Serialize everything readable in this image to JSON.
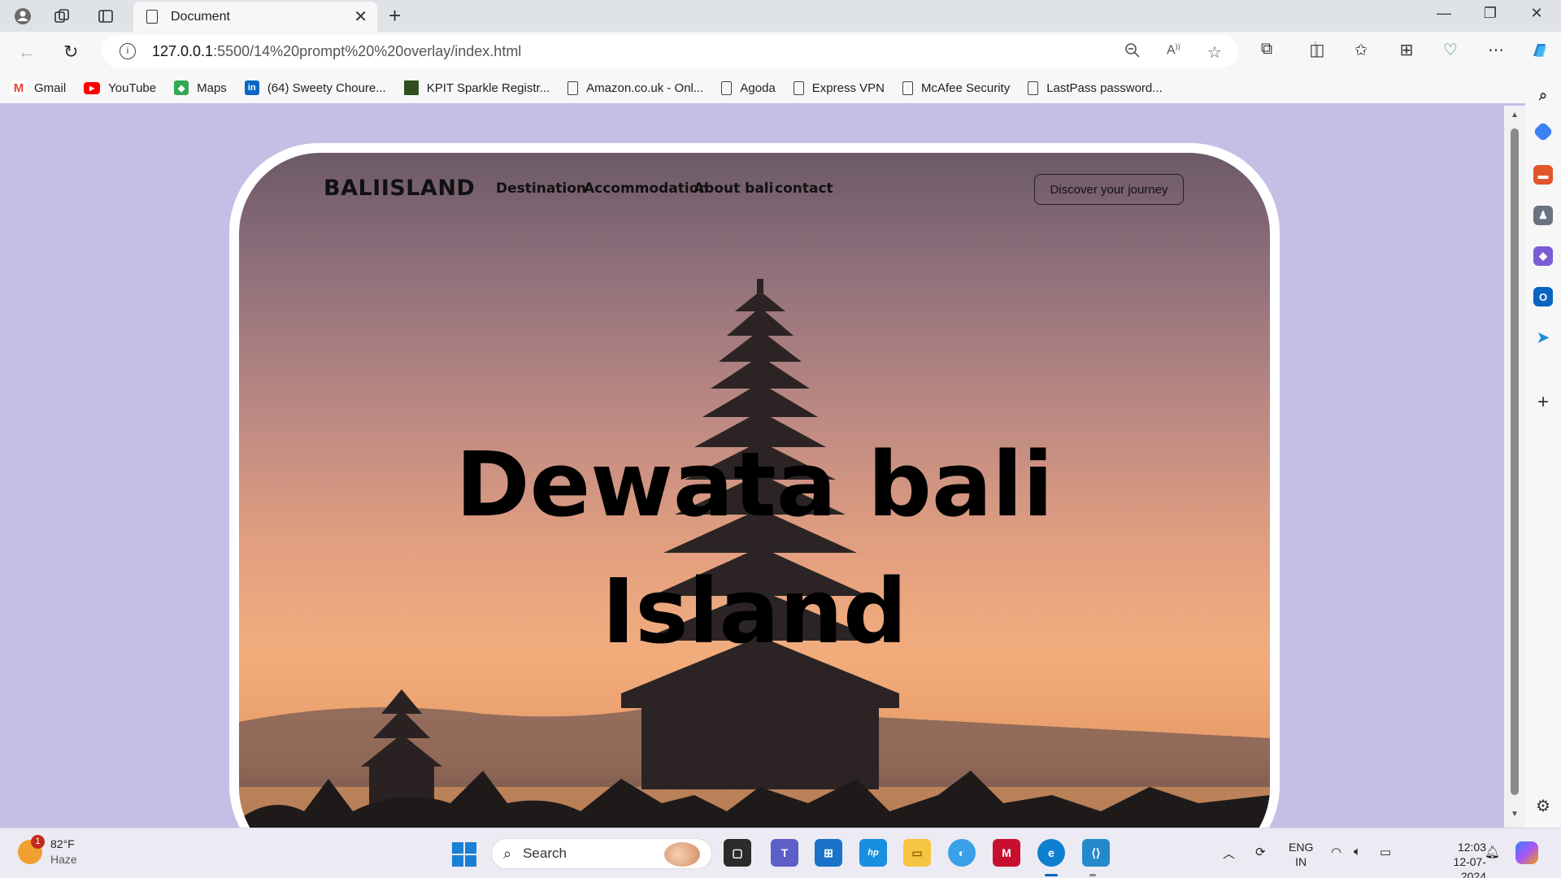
{
  "browser": {
    "tab_title": "Document",
    "url_host": "127.0.0.1",
    "url_path": ":5500/14%20prompt%20%20overlay/index.html"
  },
  "bookmarks": [
    {
      "label": "Gmail",
      "icon": "gmail-icon",
      "color": "#ea4335"
    },
    {
      "label": "YouTube",
      "icon": "youtube-icon",
      "color": "#ff0000"
    },
    {
      "label": "Maps",
      "icon": "maps-icon",
      "color": "#34a853"
    },
    {
      "label": "(64) Sweety Choure...",
      "icon": "linkedin-icon",
      "color": "#0a66c2"
    },
    {
      "label": "KPIT Sparkle Registr...",
      "icon": "kpit-icon",
      "color": "#2f4f1f"
    },
    {
      "label": "Amazon.co.uk - Onl...",
      "icon": "page-icon",
      "color": ""
    },
    {
      "label": "Agoda",
      "icon": "page-icon",
      "color": ""
    },
    {
      "label": "Express VPN",
      "icon": "page-icon",
      "color": ""
    },
    {
      "label": "McAfee Security",
      "icon": "page-icon",
      "color": ""
    },
    {
      "label": "LastPass password...",
      "icon": "page-icon",
      "color": ""
    }
  ],
  "site": {
    "logo": "BALIISLAND",
    "nav": [
      "Destination",
      "Accommodation",
      "About bali",
      "contact"
    ],
    "cta": "Discover your journey",
    "headline_line1": "Dewata bali",
    "headline_line2": "Island"
  },
  "taskbar": {
    "weather_temp": "82°F",
    "weather_cond": "Haze",
    "weather_badge": "1",
    "search_placeholder": "Search",
    "lang_line1": "ENG",
    "lang_line2": "IN",
    "time": "12:03",
    "date": "12-07-2024"
  },
  "colors": {
    "page_bg": "#c5bfe6",
    "card_bg": "#ffffff",
    "text": "#000000",
    "accent": "#0067c0"
  }
}
